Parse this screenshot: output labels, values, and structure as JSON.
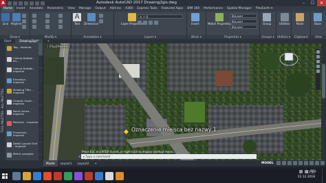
{
  "window": {
    "title": "Autodesk AutoCAD 2017   Drawing2gis.dwg",
    "minimize": "–",
    "maximize": "☐",
    "close": "✕"
  },
  "ribbon_tabs": [
    "Home",
    "Insert",
    "Annotate",
    "Parametric",
    "View",
    "Manage",
    "Output",
    "Add-ins",
    "A360",
    "Express Tools",
    "Featured Apps",
    "BIM 360",
    "Performance",
    "Spatial Manager",
    "PlexEarth ▾"
  ],
  "ribbon_active_tab": "Home",
  "ribbon_groups": {
    "draw": "Draw ▾",
    "modify": "Modify ▾",
    "annotation": "Annotation ▾",
    "layers": "Layers ▾",
    "block": "Block ▾",
    "properties": "Properties ▾",
    "groups": "Groups ▾",
    "utilities": "Utilities ▾",
    "clipboard": "Clipboard",
    "view": "View"
  },
  "ribbon_buttons": {
    "line": "Line",
    "polyline": "Polyline",
    "text": "Text",
    "dimension": "Dimension",
    "layer_properties": "Layer Properties",
    "insert": "Insert",
    "match_properties": "Match Properties",
    "group": "Group",
    "utilities": "Utilities",
    "paste": "Paste",
    "base": "Base"
  },
  "ribbon_combos": {
    "bylayer_color": "ByLayer",
    "bylayer_linetype": "ByLayer",
    "bylayer_lineweight": "ByLayer"
  },
  "doc_tabs": [
    "Start",
    "Drawing2gis*",
    "+"
  ],
  "palette": {
    "title": "TOOL PALETTES - ALL PALETTES",
    "items": [
      {
        "label": "Tag - Imperial",
        "color": "#c9a23a"
      },
      {
        "label": "Callout Bubble - Im...",
        "color": "#d0d4d9"
      },
      {
        "label": "Callout Bubble - Imperial",
        "color": "#d0d4d9"
      },
      {
        "label": "Elevation - Imperial",
        "color": "#5aa0d8"
      },
      {
        "label": "Drawing Title - Imperial",
        "color": "#c9a23a"
      },
      {
        "label": "Graphic Scale - Imperial",
        "color": "#d0d4d9"
      },
      {
        "label": "North Arrow - Imperial",
        "color": "#d0d4d9"
      },
      {
        "label": "Revision - Imperial",
        "color": "#e05a5a"
      },
      {
        "label": "Flowchart - Imperial",
        "color": "#5aa0d8"
      },
      {
        "label": "Detail Layout Grid - Imperial",
        "color": "#d0d4d9"
      },
      {
        "label": "Metric samples",
        "color": "#8a95a1"
      },
      {
        "label": "Tag - Metric",
        "color": "#c9a23a"
      }
    ]
  },
  "viewport_label": "[-][Top][Realistic]",
  "annotation_text": "Oznaczenie miejsca bez nazwy 1",
  "command": {
    "history": "Press ESC or ENTER to exit, or right-click to display shortcut menu.",
    "prompt": "▸ Type a command",
    "close": "✕"
  },
  "layout_tabs": [
    "Model",
    "Layout1",
    "Layout2",
    "+"
  ],
  "status": {
    "model": "MODEL"
  },
  "taskbar": {
    "apps": [
      "#5a7a9a",
      "#d9a52e",
      "#2f7ed8",
      "#e44d26",
      "#c0392b",
      "#2f9e5b",
      "#8a4fd8",
      "#c0392b",
      "#3a78c9",
      "#d8d8d8",
      "#e08a2e"
    ]
  },
  "tray": {
    "language": "POL",
    "time": "17:51",
    "date": "22.12.2018"
  },
  "colors": {
    "accent": "#c0392b",
    "panel": "#3e4650",
    "canvas_bg": "#2f3a2a"
  }
}
